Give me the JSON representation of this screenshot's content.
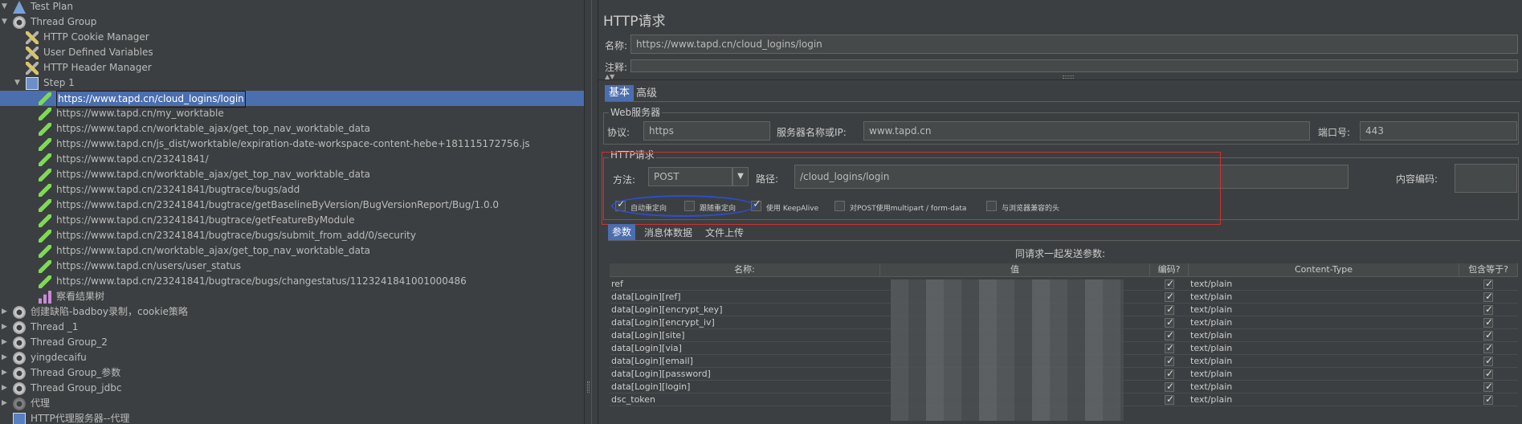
{
  "tree": {
    "items": [
      {
        "label": "Test Plan",
        "icon": "test-plan-icon",
        "toggle": "▼",
        "depth": 0
      },
      {
        "label": "Thread Group",
        "icon": "gear-icon",
        "toggle": "▼",
        "depth": 0
      },
      {
        "label": "HTTP Cookie Manager",
        "icon": "wrench-icon",
        "toggle": "",
        "depth": 1
      },
      {
        "label": "User Defined Variables",
        "icon": "wrench-icon",
        "toggle": "",
        "depth": 1
      },
      {
        "label": "HTTP Header Manager",
        "icon": "wrench-icon",
        "toggle": "",
        "depth": 1
      },
      {
        "label": "Step 1",
        "icon": "controller-icon",
        "toggle": "▼",
        "depth": 1
      },
      {
        "label": "https://www.tapd.cn/cloud_logins/login",
        "icon": "pipette-icon",
        "toggle": "",
        "depth": 2,
        "selected": true
      },
      {
        "label": "https://www.tapd.cn/my_worktable",
        "icon": "pipette-icon",
        "toggle": "",
        "depth": 2
      },
      {
        "label": "https://www.tapd.cn/worktable_ajax/get_top_nav_worktable_data",
        "icon": "pipette-icon",
        "toggle": "",
        "depth": 2
      },
      {
        "label": "https://www.tapd.cn/js_dist/worktable/expiration-date-workspace-content-hebe+181115172756.js",
        "icon": "pipette-icon",
        "toggle": "",
        "depth": 2
      },
      {
        "label": "https://www.tapd.cn/23241841/",
        "icon": "pipette-icon",
        "toggle": "",
        "depth": 2
      },
      {
        "label": "https://www.tapd.cn/worktable_ajax/get_top_nav_worktable_data",
        "icon": "pipette-icon",
        "toggle": "",
        "depth": 2
      },
      {
        "label": "https://www.tapd.cn/23241841/bugtrace/bugs/add",
        "icon": "pipette-icon",
        "toggle": "",
        "depth": 2
      },
      {
        "label": "https://www.tapd.cn/23241841/bugtrace/getBaselineByVersion/BugVersionReport/Bug/1.0.0",
        "icon": "pipette-icon",
        "toggle": "",
        "depth": 2
      },
      {
        "label": "https://www.tapd.cn/23241841/bugtrace/getFeatureByModule",
        "icon": "pipette-icon",
        "toggle": "",
        "depth": 2
      },
      {
        "label": "https://www.tapd.cn/23241841/bugtrace/bugs/submit_from_add/0/security",
        "icon": "pipette-icon",
        "toggle": "",
        "depth": 2
      },
      {
        "label": "https://www.tapd.cn/worktable_ajax/get_top_nav_worktable_data",
        "icon": "pipette-icon",
        "toggle": "",
        "depth": 2
      },
      {
        "label": "https://www.tapd.cn/users/user_status",
        "icon": "pipette-icon",
        "toggle": "",
        "depth": 2
      },
      {
        "label": "https://www.tapd.cn/23241841/bugtrace/bugs/changestatus/1123241841001000486",
        "icon": "pipette-icon",
        "toggle": "",
        "depth": 2
      },
      {
        "label": "察看结果树",
        "icon": "chart-icon",
        "toggle": "",
        "depth": 2
      },
      {
        "label": "创建缺陷-badboy录制，cookie策略",
        "icon": "gear-icon",
        "toggle": "▶",
        "depth": 0
      },
      {
        "label": "Thread _1",
        "icon": "gear-icon",
        "toggle": "▶",
        "depth": 0
      },
      {
        "label": "Thread Group_2",
        "icon": "gear-icon",
        "toggle": "▶",
        "depth": 0
      },
      {
        "label": "yingdecaifu",
        "icon": "gear-icon",
        "toggle": "▶",
        "depth": 0
      },
      {
        "label": "Thread Group_参数",
        "icon": "gear-icon",
        "toggle": "▶",
        "depth": 0
      },
      {
        "label": "Thread Group_jdbc",
        "icon": "gear-icon",
        "toggle": "▶",
        "depth": 0
      },
      {
        "label": "代理",
        "icon": "gear-disabled-icon",
        "toggle": "▶",
        "depth": 0
      },
      {
        "label": "HTTP代理服务器--代理",
        "icon": "proxy-icon",
        "toggle": "",
        "depth": 0
      }
    ]
  },
  "panel": {
    "title": "HTTP请求",
    "name_label": "名称:",
    "name_value": "https://www.tapd.cn/cloud_logins/login",
    "comment_label": "注释:",
    "tabs": [
      "基本",
      "高级"
    ],
    "web_server": {
      "title": "Web服务器",
      "protocol_label": "协议:",
      "protocol_value": "https",
      "server_label": "服务器名称或IP:",
      "server_value": "www.tapd.cn",
      "port_label": "端口号:",
      "port_value": "443"
    },
    "http_request": {
      "title": "HTTP请求",
      "method_label": "方法:",
      "method_value": "POST",
      "path_label": "路径:",
      "path_value": "/cloud_logins/login",
      "encoding_label": "内容编码:",
      "checkboxes": [
        {
          "label": "自动重定向",
          "checked": true
        },
        {
          "label": "跟随重定向",
          "checked": false
        },
        {
          "label": "使用 KeepAlive",
          "checked": true
        },
        {
          "label": "对POST使用multipart / form-data",
          "checked": false
        },
        {
          "label": "与浏览器兼容的头",
          "checked": false
        }
      ]
    },
    "sub_tabs": [
      "参数",
      "消息体数据",
      "文件上传"
    ],
    "params_title": "同请求一起发送参数:",
    "columns": [
      "名称:",
      "值",
      "编码?",
      "Content-Type",
      "包含等于?"
    ],
    "rows": [
      {
        "name": "ref",
        "type": "text/plain"
      },
      {
        "name": "data[Login][ref]",
        "type": "text/plain"
      },
      {
        "name": "data[Login][encrypt_key]",
        "type": "text/plain"
      },
      {
        "name": "data[Login][encrypt_iv]",
        "type": "text/plain"
      },
      {
        "name": "data[Login][site]",
        "type": "text/plain"
      },
      {
        "name": "data[Login][via]",
        "type": "text/plain"
      },
      {
        "name": "data[Login][email]",
        "type": "text/plain"
      },
      {
        "name": "data[Login][password]",
        "type": "text/plain"
      },
      {
        "name": "data[Login][login]",
        "type": "text/plain"
      },
      {
        "name": "dsc_token",
        "type": "text/plain"
      }
    ]
  },
  "colors": {
    "selection": "#4b6eaf",
    "annotation_red": "#d03030",
    "annotation_blue": "#2a4fd0"
  }
}
